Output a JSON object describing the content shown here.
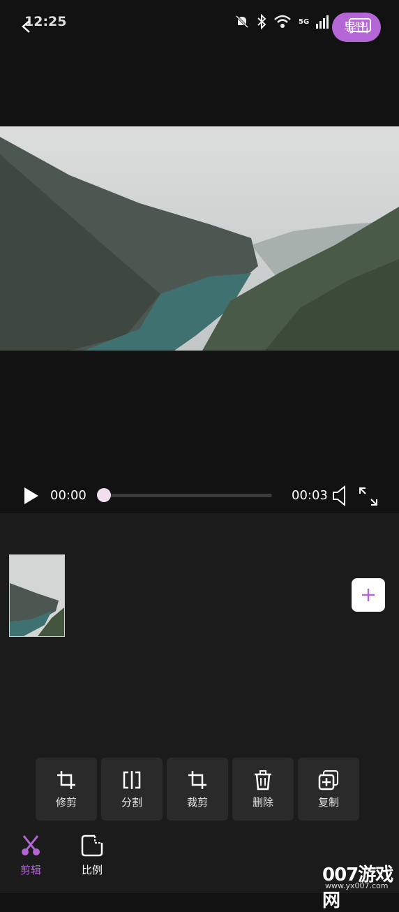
{
  "status_bar": {
    "time": "12:25",
    "battery": "89",
    "network_1": "5G",
    "network_2": "5G"
  },
  "header": {
    "back_icon": "back-arrow-icon",
    "export_label": "导出",
    "accent_color": "#b566d6"
  },
  "player": {
    "current_time": "00:00",
    "total_time": "00:03",
    "progress": 0
  },
  "tools": [
    {
      "label": "修剪",
      "icon": "trim-icon"
    },
    {
      "label": "分割",
      "icon": "split-icon"
    },
    {
      "label": "裁剪",
      "icon": "crop-icon"
    },
    {
      "label": "删除",
      "icon": "delete-icon"
    },
    {
      "label": "复制",
      "icon": "duplicate-icon"
    }
  ],
  "bottom_nav": [
    {
      "label": "剪辑",
      "icon": "scissors-icon",
      "active": true
    },
    {
      "label": "比例",
      "icon": "ratio-icon",
      "active": false
    }
  ],
  "watermark": {
    "title": "007游戏网",
    "url": "www.yx007.com"
  }
}
